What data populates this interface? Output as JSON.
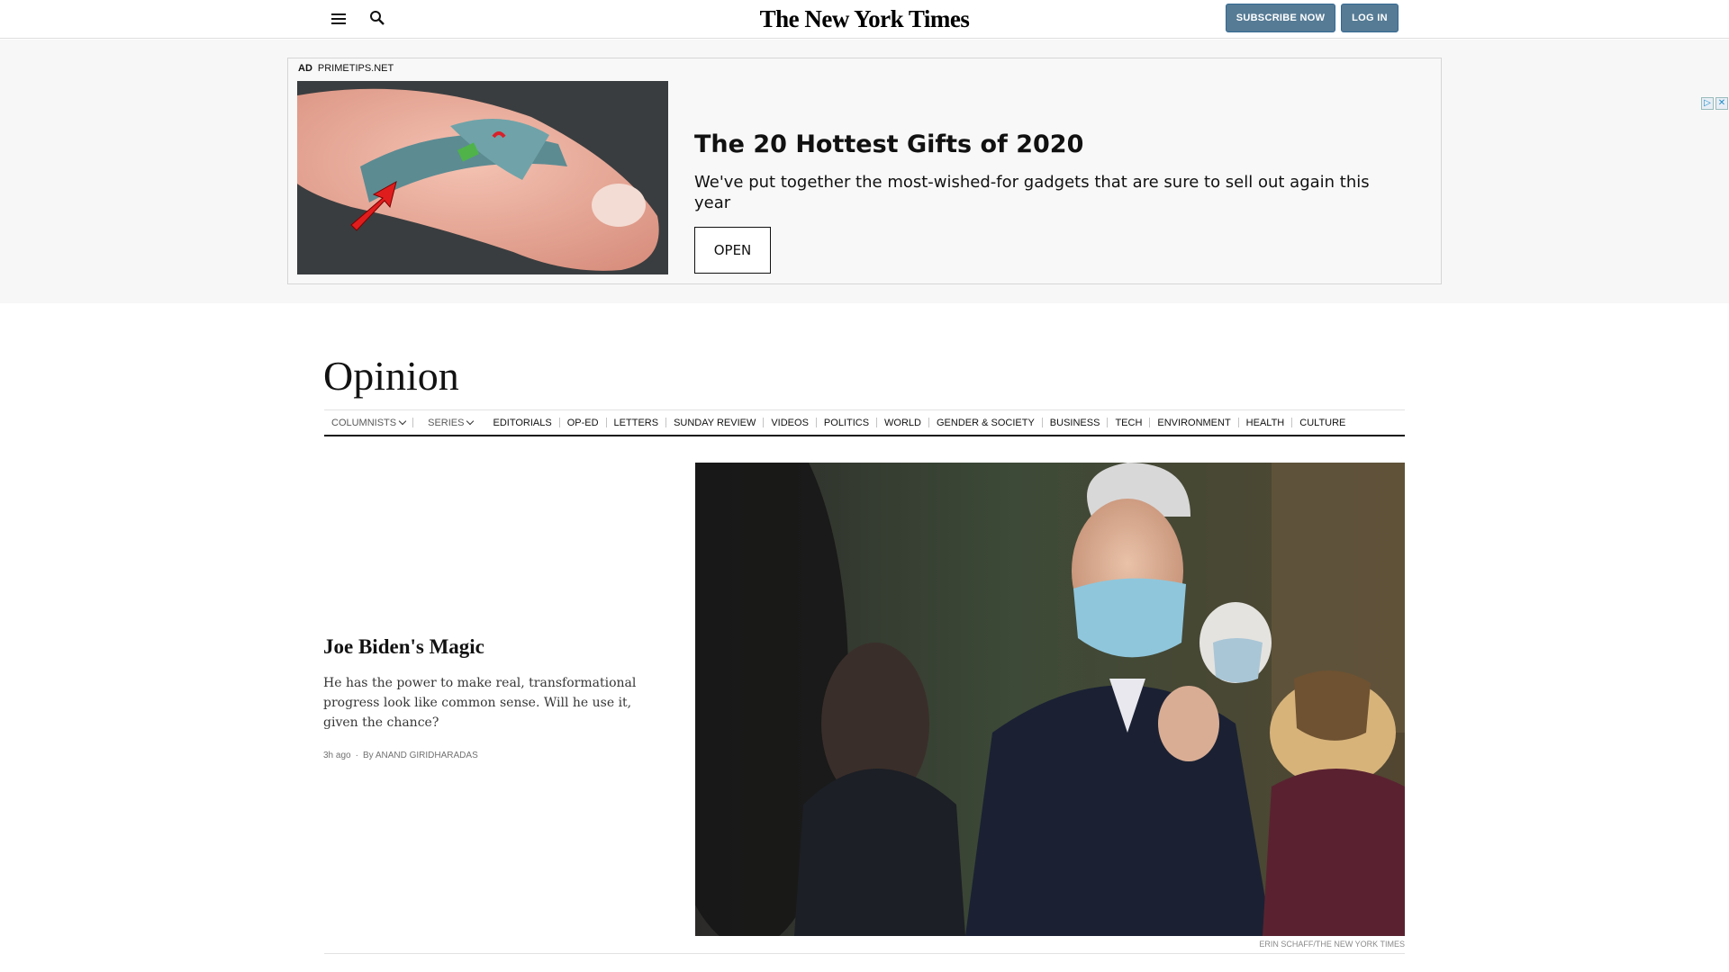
{
  "header": {
    "logo": "The New York Times",
    "subscribe_label": "SUBSCRIBE NOW",
    "login_label": "LOG IN"
  },
  "ad": {
    "ad_tag": "AD",
    "advertiser": "PRIMETIPS.NET",
    "title": "The 20 Hottest Gifts of 2020",
    "description": "We've put together the most-wished-for gadgets that are sure to sell out again this year",
    "cta_label": "OPEN"
  },
  "opinion": {
    "section_title": "Opinion",
    "nav": [
      {
        "label": "COLUMNISTS"
      },
      {
        "label": "SERIES"
      },
      {
        "label": "EDITORIALS"
      },
      {
        "label": "OP-ED"
      },
      {
        "label": "LETTERS"
      },
      {
        "label": "SUNDAY REVIEW"
      },
      {
        "label": "VIDEOS"
      },
      {
        "label": "POLITICS"
      },
      {
        "label": "WORLD"
      },
      {
        "label": "GENDER & SOCIETY"
      },
      {
        "label": "BUSINESS"
      },
      {
        "label": "TECH"
      },
      {
        "label": "ENVIRONMENT"
      },
      {
        "label": "HEALTH"
      },
      {
        "label": "CULTURE"
      }
    ]
  },
  "lead_story": {
    "headline": "Joe Biden's Magic",
    "summary": "He has the power to make real, transformational progress look like common sense. Will he use it, given the chance?",
    "time": "3h ago",
    "byline": "By ANAND GIRIDHARADAS",
    "photo_credit": "ERIN SCHAFF/THE NEW YORK TIMES"
  }
}
